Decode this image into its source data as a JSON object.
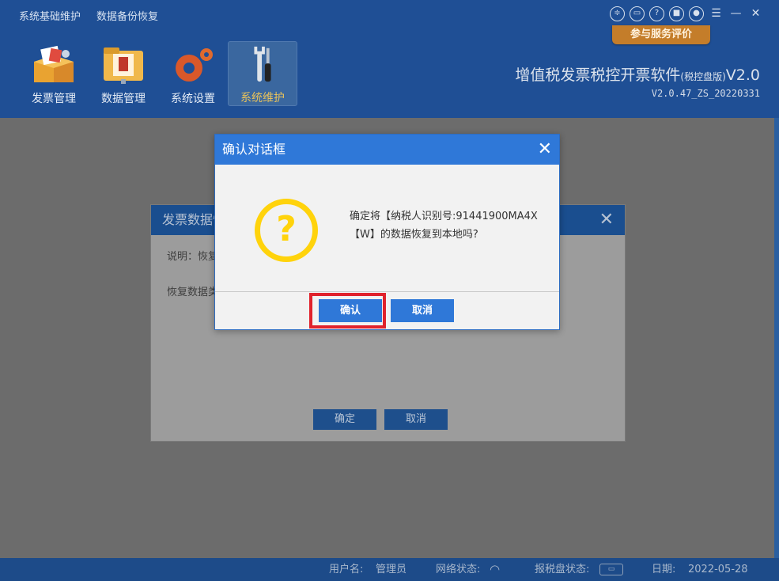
{
  "header": {
    "top_menu": [
      "系统基础维护",
      "数据备份恢复"
    ],
    "evaluate_button": "参与服务评价",
    "nav": [
      {
        "label": "发票管理",
        "icon": "invoice-box-icon",
        "active": false
      },
      {
        "label": "数据管理",
        "icon": "folder-icon",
        "active": false
      },
      {
        "label": "系统设置",
        "icon": "gear-icon",
        "active": false
      },
      {
        "label": "系统维护",
        "icon": "wrench-screwdriver-icon",
        "active": true
      }
    ],
    "brand_title": "增值税发票税控开票软件",
    "brand_edition": "(税控盘版)",
    "brand_version_tag": "V2.0",
    "brand_build": "V2.0.47_ZS_20220331"
  },
  "background_dialog": {
    "title": "发票数据恢",
    "description_label": "说明：恢复",
    "restore_label": "恢复数据类",
    "ok_label": "确定",
    "cancel_label": "取消"
  },
  "confirm_dialog": {
    "title": "确认对话框",
    "message_line1": "确定将【纳税人识别号:91441900MA4X",
    "message_line2": "【W】的数据恢复到本地吗?",
    "ok_label": "确认",
    "cancel_label": "取消"
  },
  "statusbar": {
    "user_label": "用户名:",
    "user_value": "管理员",
    "network_label": "网络状态:",
    "disk_label": "报税盘状态:",
    "date_label": "日期:",
    "date_value": "2022-05-28"
  },
  "colors": {
    "header_bg": "#1f4f95",
    "dialog_title": "#2f78d8",
    "question_icon": "#ffd30c",
    "highlight_border": "#e0222c",
    "evaluate_button": "#c47d2a"
  }
}
